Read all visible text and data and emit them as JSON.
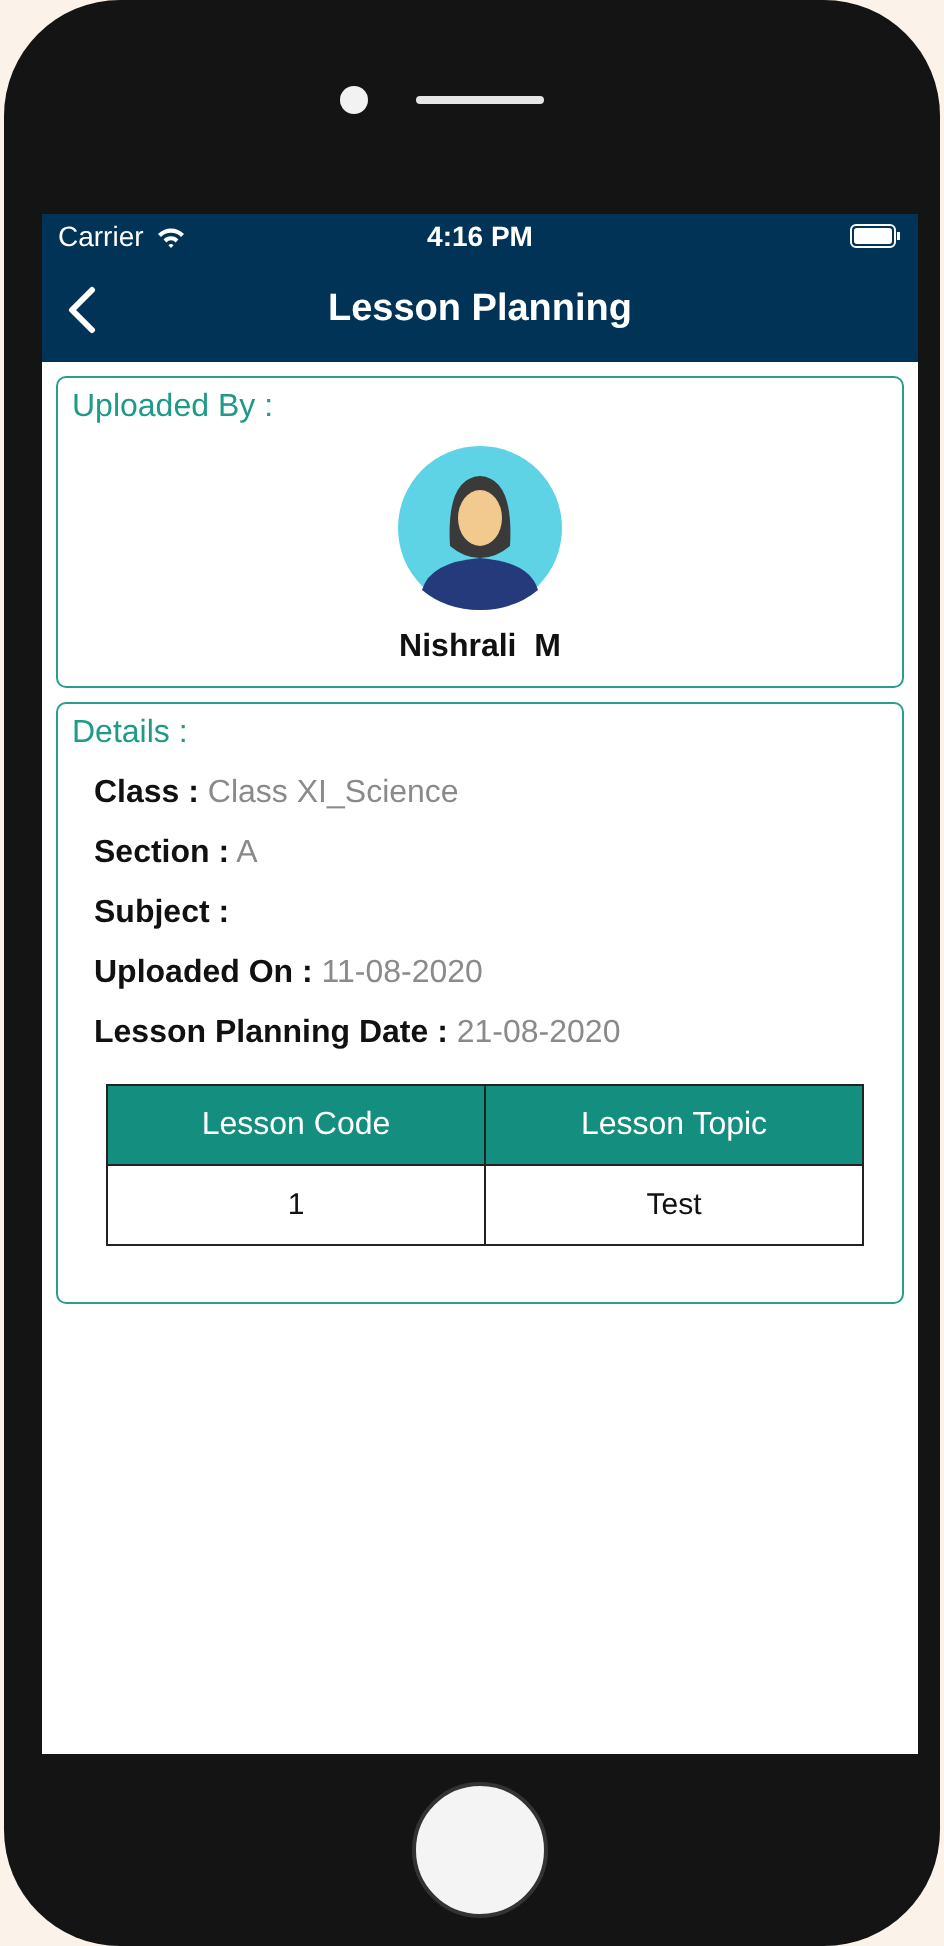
{
  "status_bar": {
    "carrier": "Carrier",
    "time": "4:16 PM"
  },
  "nav_bar": {
    "title": "Lesson Planning"
  },
  "uploaded_by": {
    "heading": "Uploaded By :",
    "name": "Nishrali  M"
  },
  "details": {
    "heading": "Details :",
    "fields": [
      {
        "label": "Class :",
        "value": "Class XI_Science"
      },
      {
        "label": "Section :",
        "value": "A"
      },
      {
        "label": "Subject :"
      },
      {
        "label": "Uploaded On :",
        "value": "11-08-2020"
      },
      {
        "label": "Lesson Planning Date :",
        "value": "21-08-2020"
      }
    ],
    "table": {
      "columns": [
        "Lesson Code",
        "Lesson Topic"
      ],
      "rows": [
        [
          "1",
          "Test"
        ]
      ]
    }
  }
}
